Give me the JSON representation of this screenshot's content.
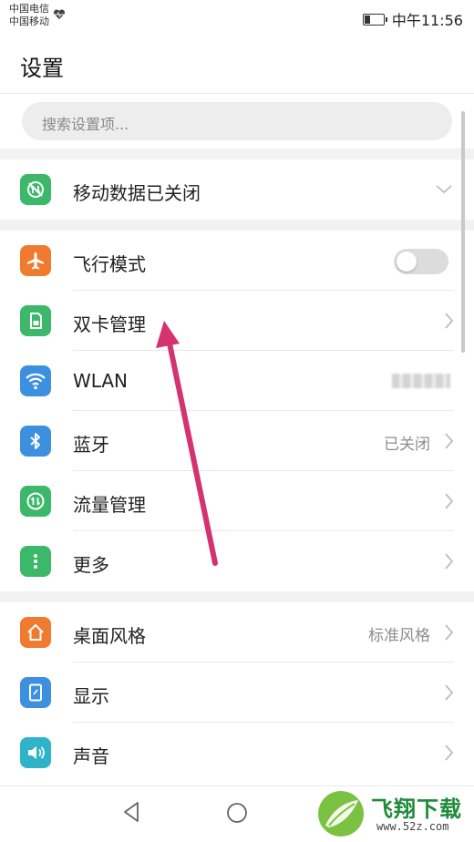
{
  "status_bar": {
    "carrier1": "中国电信",
    "carrier2": "中国移动",
    "time": "中午11:56"
  },
  "header": {
    "title": "设置"
  },
  "search": {
    "placeholder": "搜索设置项..."
  },
  "rows": {
    "mobile_data": {
      "label": "移动数据已关闭"
    },
    "airplane": {
      "label": "飞行模式",
      "toggle_on": false
    },
    "dual_sim": {
      "label": "双卡管理"
    },
    "wlan": {
      "label": "WLAN"
    },
    "bluetooth": {
      "label": "蓝牙",
      "value": "已关闭"
    },
    "traffic": {
      "label": "流量管理"
    },
    "more": {
      "label": "更多"
    },
    "desktop": {
      "label": "桌面风格",
      "value": "标准风格"
    },
    "display": {
      "label": "显示"
    },
    "sound": {
      "label": "声音"
    }
  },
  "watermark": {
    "text": "飞翔下载",
    "url": "www.52z.com"
  },
  "colors": {
    "green": "#3cb86a",
    "orange": "#f07a2e",
    "blue": "#3d8fe0",
    "teal": "#2fb3c9",
    "arrow": "#d4336f"
  },
  "icons": {
    "mobile_data": "mobile-data-off-icon",
    "airplane": "airplane-icon",
    "dual_sim": "sim-card-icon",
    "wlan": "wifi-icon",
    "bluetooth": "bluetooth-icon",
    "traffic": "traffic-arrows-icon",
    "more": "more-dots-icon",
    "desktop": "home-icon",
    "display": "display-icon",
    "sound": "speaker-icon"
  }
}
